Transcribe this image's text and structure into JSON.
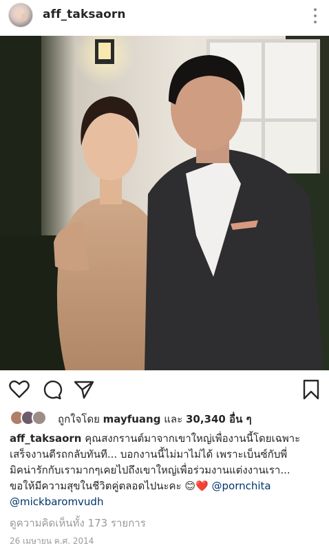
{
  "header": {
    "username": "aff_taksaorn",
    "avatar_icon": "profile-avatar",
    "more_icon": "more-vertical-icon"
  },
  "photo": {
    "icon": "post-photo-couple"
  },
  "actions": {
    "like_icon": "heart-icon",
    "comment_icon": "comment-icon",
    "share_icon": "send-icon",
    "save_icon": "bookmark-icon"
  },
  "likes": {
    "prefix": "ถูกใจโดย",
    "user": "mayfuang",
    "conjunction": "และ",
    "count": "30,340 อื่น ๆ"
  },
  "caption": {
    "author": "aff_taksaorn",
    "line1": " คุณสงกรานต์มาจากเขาใหญ่เพื่องานนี้โดยเฉพาะ",
    "line2": "เสร็จงานตีรถกลับทันที... บอกงานนี้ไม่มาไม่ได้ เพราะเบ็นซ์กับพี่",
    "line3": "มิคน่ารักกับเรามากๆเคยไปถึงเขาใหญ่เพื่อร่วมงานแต่งงานเรา...",
    "line4": "ขอให้มีความสุขในชีวิตคู่ตลอดไปนะคะ 😊❤️ ",
    "mention1": "@pornchita",
    "mention2": "@mickbaromvudh"
  },
  "comments_link": "ดูความคิดเห็นทั้ง 173 รายการ",
  "date": "26 เมษายน ค.ศ. 2014"
}
